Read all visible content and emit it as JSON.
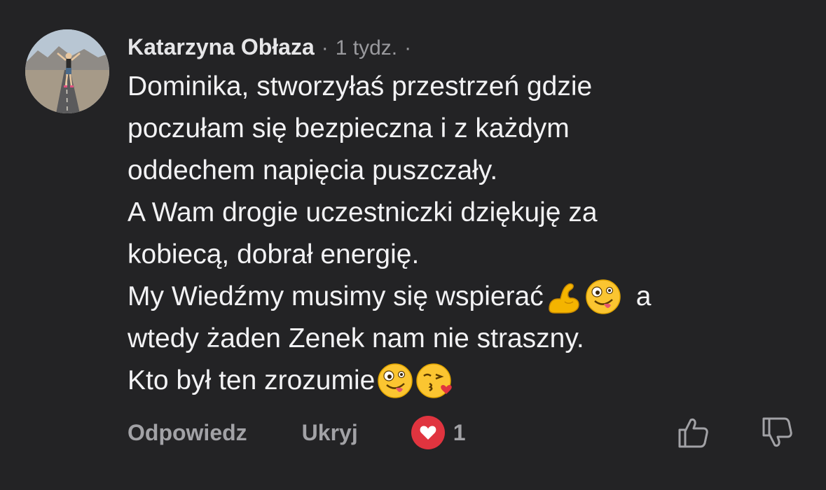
{
  "comment": {
    "author": "Katarzyna Obłaza",
    "separator": "·",
    "time": "1 tydz.",
    "lines": [
      "Dominika, stworzyłaś przestrzeń gdzie",
      "poczułam się bezpieczna i z każdym",
      "oddechem napięcia puszczały.",
      "A Wam drogie uczestniczki dziękuję za",
      "kobiecą, dobrał energię.",
      "My Wiedźmy musimy się wspierać",
      "a",
      "wtedy żaden Zenek nam nie straszny.",
      "Kto był ten zrozumie"
    ],
    "emoji": {
      "line6": [
        "flexed-biceps",
        "zany-face"
      ],
      "line9": [
        "zany-face",
        "face-blowing-kiss"
      ]
    }
  },
  "actions": {
    "reply": "Odpowiedz",
    "hide": "Ukryj",
    "reaction_count": "1",
    "reaction_icon": "heart-icon",
    "like_icon": "thumbs-up-icon",
    "dislike_icon": "thumbs-down-icon"
  },
  "colors": {
    "background": "#232325",
    "text": "#f2f2f4",
    "muted": "#a2a2a6",
    "heart": "#e0343f"
  }
}
